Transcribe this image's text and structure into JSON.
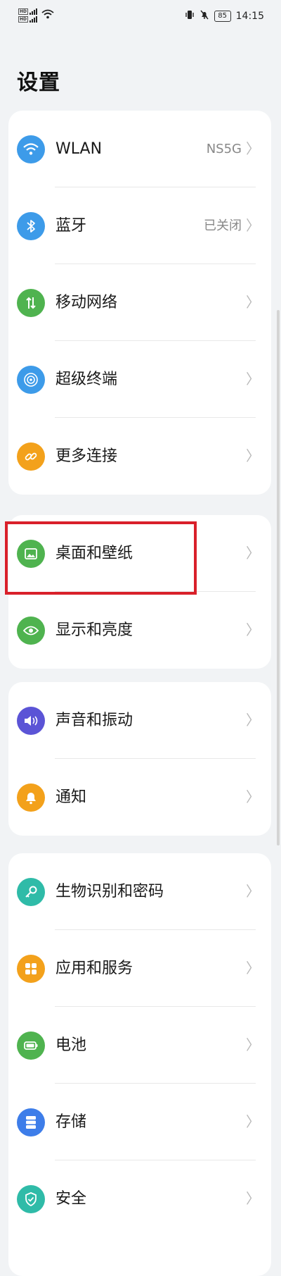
{
  "status_bar": {
    "sim1": "HD",
    "sim2": "HD",
    "battery": "85",
    "time": "14:15"
  },
  "page": {
    "title": "设置"
  },
  "groups": [
    {
      "items": [
        {
          "label": "WLAN",
          "value": "NS5G",
          "icon": "wifi-icon",
          "color": "#3d9be9"
        },
        {
          "label": "蓝牙",
          "value": "已关闭",
          "icon": "bluetooth-icon",
          "color": "#3d9be9"
        },
        {
          "label": "移动网络",
          "value": "",
          "icon": "mobile-network-icon",
          "color": "#4fb34f"
        },
        {
          "label": "超级终端",
          "value": "",
          "icon": "super-device-icon",
          "color": "#3d9be9"
        },
        {
          "label": "更多连接",
          "value": "",
          "icon": "link-icon",
          "color": "#f3a11b"
        }
      ]
    },
    {
      "items": [
        {
          "label": "桌面和壁纸",
          "value": "",
          "icon": "wallpaper-icon",
          "color": "#4fb34f"
        },
        {
          "label": "显示和亮度",
          "value": "",
          "icon": "display-icon",
          "color": "#4fb34f"
        }
      ]
    },
    {
      "items": [
        {
          "label": "声音和振动",
          "value": "",
          "icon": "sound-icon",
          "color": "#5b54d6"
        },
        {
          "label": "通知",
          "value": "",
          "icon": "notification-icon",
          "color": "#f3a11b"
        }
      ]
    },
    {
      "items": [
        {
          "label": "生物识别和密码",
          "value": "",
          "icon": "key-icon",
          "color": "#2fbba8"
        },
        {
          "label": "应用和服务",
          "value": "",
          "icon": "apps-icon",
          "color": "#f3a11b"
        },
        {
          "label": "电池",
          "value": "",
          "icon": "battery-icon",
          "color": "#4fb34f"
        },
        {
          "label": "存储",
          "value": "",
          "icon": "storage-icon",
          "color": "#3d7de9"
        },
        {
          "label": "安全",
          "value": "",
          "icon": "security-icon",
          "color": "#2fbba8"
        }
      ]
    }
  ]
}
